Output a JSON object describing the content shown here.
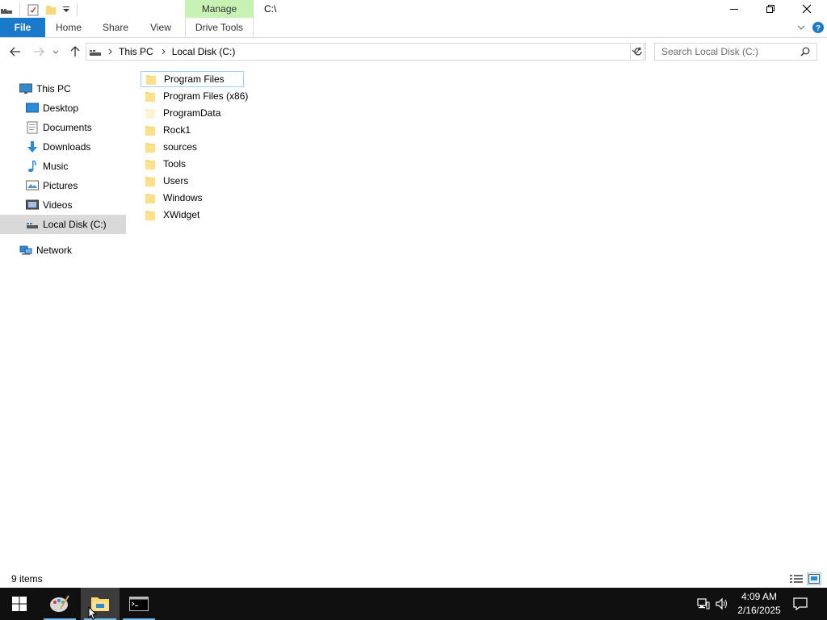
{
  "window": {
    "title": "C:\\",
    "context_tab_group": "Manage"
  },
  "ribbon": {
    "tabs": [
      {
        "label": "File"
      },
      {
        "label": "Home"
      },
      {
        "label": "Share"
      },
      {
        "label": "View"
      },
      {
        "label": "Drive Tools"
      }
    ]
  },
  "address": {
    "crumbs": [
      "This PC",
      "Local Disk (C:)"
    ]
  },
  "search": {
    "placeholder": "Search Local Disk (C:)"
  },
  "navpane": {
    "items": [
      {
        "label": "This PC",
        "icon": "pc-icon"
      },
      {
        "label": "Desktop",
        "icon": "desktop-icon"
      },
      {
        "label": "Documents",
        "icon": "documents-icon"
      },
      {
        "label": "Downloads",
        "icon": "downloads-icon"
      },
      {
        "label": "Music",
        "icon": "music-icon"
      },
      {
        "label": "Pictures",
        "icon": "pictures-icon"
      },
      {
        "label": "Videos",
        "icon": "videos-icon"
      },
      {
        "label": "Local Disk (C:)",
        "icon": "drive-icon"
      },
      {
        "label": "Network",
        "icon": "network-icon"
      }
    ]
  },
  "files": [
    {
      "name": "Program Files"
    },
    {
      "name": "Program Files (x86)"
    },
    {
      "name": "ProgramData"
    },
    {
      "name": "Rock1"
    },
    {
      "name": "sources"
    },
    {
      "name": "Tools"
    },
    {
      "name": "Users"
    },
    {
      "name": "Windows"
    },
    {
      "name": "XWidget"
    }
  ],
  "status": {
    "item_count": "9 items"
  },
  "taskbar": {
    "time": "4:09 AM",
    "date": "2/16/2025"
  },
  "colors": {
    "accent": "#1979ca",
    "context_tab": "#c8f1b4",
    "selection": "#cce8ff",
    "folder": "#f8d775",
    "taskbar": "#101010"
  }
}
